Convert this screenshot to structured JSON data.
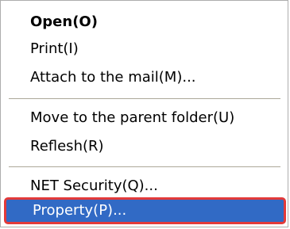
{
  "menu": {
    "items": [
      {
        "label": "Open(O)"
      },
      {
        "label": "Print(I)"
      },
      {
        "label": "Attach to the mail(M)..."
      },
      {
        "label": "Move to the parent folder(U)"
      },
      {
        "label": "Reflesh(R)"
      },
      {
        "label": "NET Security(Q)..."
      },
      {
        "label": "Property(P)..."
      }
    ]
  },
  "colors": {
    "highlight": "#316ac5",
    "highlight_outline": "#e23a3a"
  }
}
